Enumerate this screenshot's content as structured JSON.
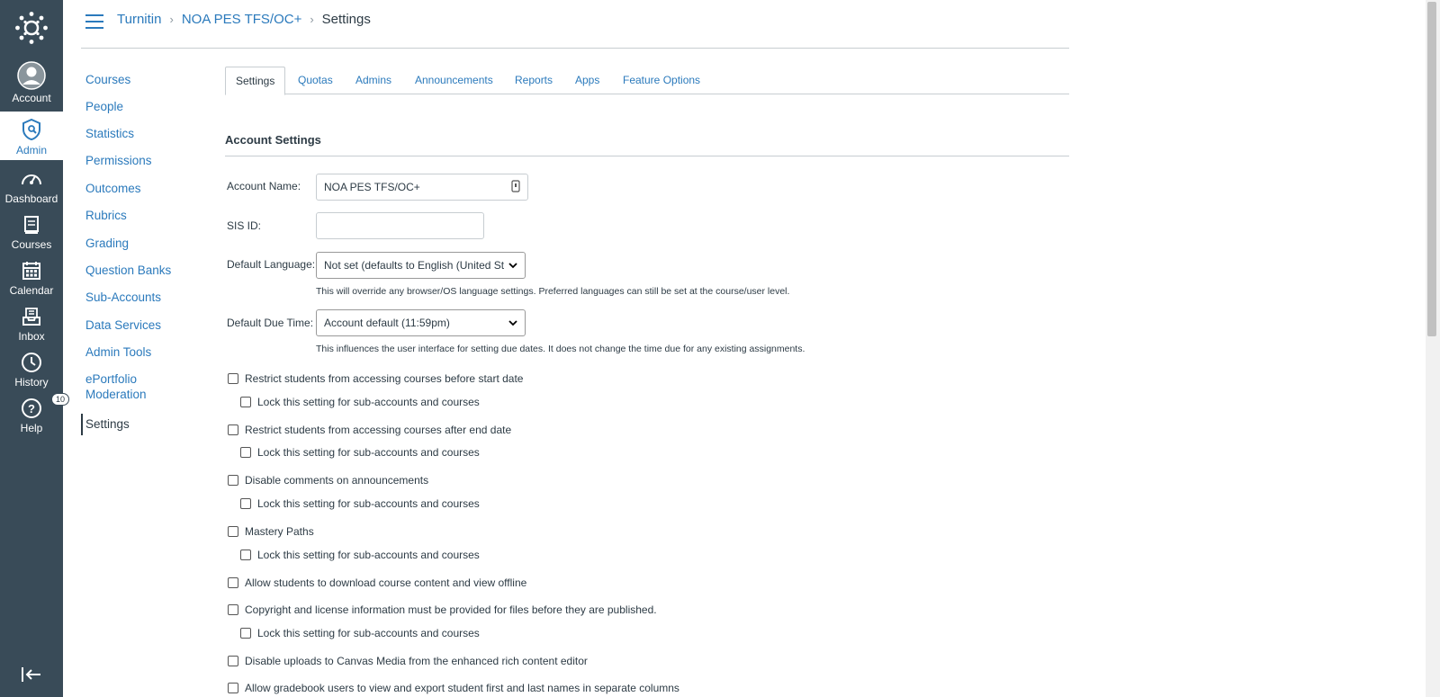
{
  "gnav": {
    "items": [
      {
        "label": "Account",
        "icon": "user-avatar-icon"
      },
      {
        "label": "Admin",
        "icon": "shield-icon"
      },
      {
        "label": "Dashboard",
        "icon": "speedometer-icon"
      },
      {
        "label": "Courses",
        "icon": "book-icon"
      },
      {
        "label": "Calendar",
        "icon": "calendar-icon"
      },
      {
        "label": "Inbox",
        "icon": "inbox-icon"
      },
      {
        "label": "History",
        "icon": "clock-icon"
      },
      {
        "label": "Help",
        "icon": "help-icon"
      }
    ],
    "help_badge": "10"
  },
  "breadcrumb": [
    "Turnitin",
    "NOA PES TFS/OC+",
    "Settings"
  ],
  "leftnav": [
    "Courses",
    "People",
    "Statistics",
    "Permissions",
    "Outcomes",
    "Rubrics",
    "Grading",
    "Question Banks",
    "Sub-Accounts",
    "Data Services",
    "Admin Tools",
    "ePortfolio Moderation",
    "Settings"
  ],
  "tabs": [
    "Settings",
    "Quotas",
    "Admins",
    "Announcements",
    "Reports",
    "Apps",
    "Feature Options"
  ],
  "section_title": "Account Settings",
  "form": {
    "account_name_label": "Account Name:",
    "account_name_value": "NOA PES TFS/OC+",
    "sis_id_label": "SIS ID:",
    "sis_id_value": "",
    "language_label": "Default Language:",
    "language_value": "Not set (defaults to English (United Stat",
    "language_hint": "This will override any browser/OS language settings. Preferred languages can still be set at the course/user level.",
    "due_time_label": "Default Due Time:",
    "due_time_value": "Account default (11:59pm)",
    "due_time_hint": "This influences the user interface for setting due dates. It does not change the time due for any existing assignments."
  },
  "checkboxes": [
    {
      "label": "Restrict students from accessing courses before start date",
      "checked": false
    },
    {
      "label": "Lock this setting for sub-accounts and courses",
      "checked": false
    },
    {
      "label": "Restrict students from accessing courses after end date",
      "checked": false
    },
    {
      "label": "Lock this setting for sub-accounts and courses",
      "checked": false
    },
    {
      "label": "Disable comments on announcements",
      "checked": false
    },
    {
      "label": "Lock this setting for sub-accounts and courses",
      "checked": false
    },
    {
      "label": "Mastery Paths",
      "checked": false
    },
    {
      "label": "Lock this setting for sub-accounts and courses",
      "checked": false
    },
    {
      "label": "Allow students to download course content and view offline",
      "checked": false
    },
    {
      "label": "Copyright and license information must be provided for files before they are published.",
      "checked": false
    },
    {
      "label": "Lock this setting for sub-accounts and courses",
      "checked": false
    },
    {
      "label": "Disable uploads to Canvas Media from the enhanced rich content editor",
      "checked": false
    },
    {
      "label": "Allow gradebook users to view and export student first and last names in separate columns",
      "checked": false
    }
  ],
  "colors": {
    "nav_bg": "#394b58",
    "link": "#2b7abc",
    "text": "#2d3b45"
  }
}
